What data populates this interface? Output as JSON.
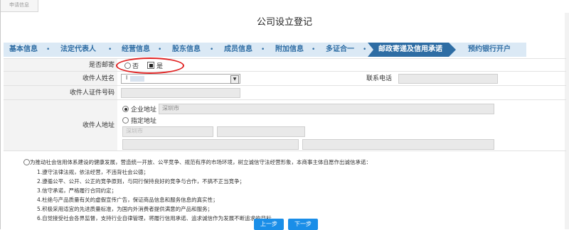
{
  "top_tab": "申请信息",
  "page_title": "公司设立登记",
  "steps": [
    "基本信息",
    "法定代表人",
    "经营信息",
    "股东信息",
    "成员信息",
    "附加信息",
    "多证合一",
    "邮政寄递及信用承诺",
    "预约银行开户"
  ],
  "active_step_index": 7,
  "colors": {
    "step_bar": "#dbe9f5",
    "active_step": "#2e6da4",
    "step_text": "#2e6da4",
    "highlight": "#e02020",
    "button": "#1a8ee8"
  },
  "form": {
    "mail_label": "是否邮寄",
    "mail_options": [
      "否",
      "是"
    ],
    "recipient_name_label": "收件人姓名",
    "recipient_name_value": "l",
    "phone_label": "联系电话",
    "id_label": "收件人证件号码",
    "address_label": "收件人地址",
    "address_option1": "企业地址",
    "address_option1_value": "深圳市",
    "address_option2": "指定地址",
    "address_option2_city": "深圳市"
  },
  "promise_intro": "为推动社会信用体系建设的健康发展，营造统一开放、公平竞争、规范有序的市场环境，树立诚信守法经营形象，本商事主体自愿作出诚信承诺：",
  "promise_lines": [
    "1.遵守法律法规，依法经营，不违背社会公德；",
    "2.遵循公平、公开、公正的竞争原则，与同行保持良好的竞争与合作，不搞不正当竞争；",
    "3.信守承诺，严格履行合同约定；",
    "4.杜绝与产品质量有关的虚假宣传广告，保证商品信息和服务信息的真实性；",
    "5.积极采用适宜的先进质量标准，为国内外消费者提供满意的产品和服务；",
    "6.自觉接受社会各界监督，支持行业自律管理，将履行信用承诺、追求诚信作为发展不断追求的目标。"
  ],
  "buttons": {
    "prev": "上一步",
    "next": "下一步"
  }
}
